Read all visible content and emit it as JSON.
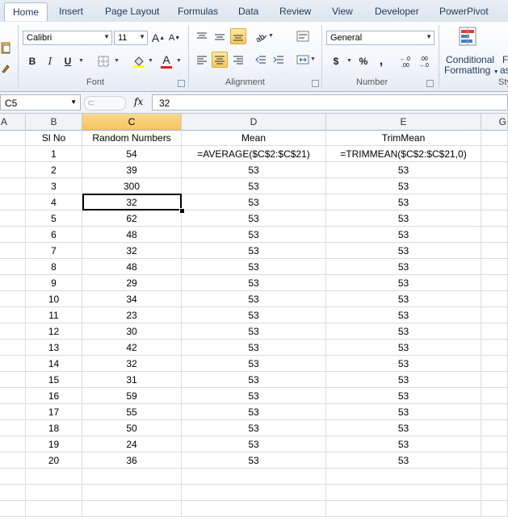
{
  "ribbon": {
    "tabs": [
      "Home",
      "Insert",
      "Page Layout",
      "Formulas",
      "Data",
      "Review",
      "View",
      "Developer",
      "PowerPivot"
    ],
    "active_tab": "Home",
    "font": {
      "name": "Calibri",
      "size": "11",
      "grow_label": "A",
      "shrink_label": "A",
      "bold": "B",
      "italic": "I",
      "underline": "U",
      "font_color_letter": "A",
      "label": "Font"
    },
    "alignment": {
      "label": "Alignment"
    },
    "number": {
      "format": "General",
      "currency": "$",
      "percent": "%",
      "comma": ",",
      "label": "Number"
    },
    "styles": {
      "conditional_line1": "Conditional",
      "conditional_line2": "Formatting",
      "cut_label1": "F",
      "cut_label2": "as",
      "cut_group": "Sty"
    }
  },
  "formula_bar": {
    "name_box": "C5",
    "fx": "fx",
    "content": "32"
  },
  "columns": [
    "A",
    "B",
    "C",
    "D",
    "E",
    "G"
  ],
  "selected_column": "C",
  "header_row": [
    "",
    "Sl No",
    "Random Numbers",
    "Mean",
    "TrimMean"
  ],
  "rows": [
    {
      "sl": "1",
      "num": "54",
      "mean": "=AVERAGE($C$2:$C$21)",
      "trim": "=TRIMMEAN($C$2:$C$21,0)"
    },
    {
      "sl": "2",
      "num": "39",
      "mean": "53",
      "trim": "53"
    },
    {
      "sl": "3",
      "num": "300",
      "mean": "53",
      "trim": "53"
    },
    {
      "sl": "4",
      "num": "32",
      "mean": "53",
      "trim": "53"
    },
    {
      "sl": "5",
      "num": "62",
      "mean": "53",
      "trim": "53"
    },
    {
      "sl": "6",
      "num": "48",
      "mean": "53",
      "trim": "53"
    },
    {
      "sl": "7",
      "num": "32",
      "mean": "53",
      "trim": "53"
    },
    {
      "sl": "8",
      "num": "48",
      "mean": "53",
      "trim": "53"
    },
    {
      "sl": "9",
      "num": "29",
      "mean": "53",
      "trim": "53"
    },
    {
      "sl": "10",
      "num": "34",
      "mean": "53",
      "trim": "53"
    },
    {
      "sl": "11",
      "num": "23",
      "mean": "53",
      "trim": "53"
    },
    {
      "sl": "12",
      "num": "30",
      "mean": "53",
      "trim": "53"
    },
    {
      "sl": "13",
      "num": "42",
      "mean": "53",
      "trim": "53"
    },
    {
      "sl": "14",
      "num": "32",
      "mean": "53",
      "trim": "53"
    },
    {
      "sl": "15",
      "num": "31",
      "mean": "53",
      "trim": "53"
    },
    {
      "sl": "16",
      "num": "59",
      "mean": "53",
      "trim": "53"
    },
    {
      "sl": "17",
      "num": "55",
      "mean": "53",
      "trim": "53"
    },
    {
      "sl": "18",
      "num": "50",
      "mean": "53",
      "trim": "53"
    },
    {
      "sl": "19",
      "num": "24",
      "mean": "53",
      "trim": "53"
    },
    {
      "sl": "20",
      "num": "36",
      "mean": "53",
      "trim": "53"
    }
  ],
  "colors": {
    "selection": "#f6c35a",
    "grid": "#dadcdd"
  }
}
